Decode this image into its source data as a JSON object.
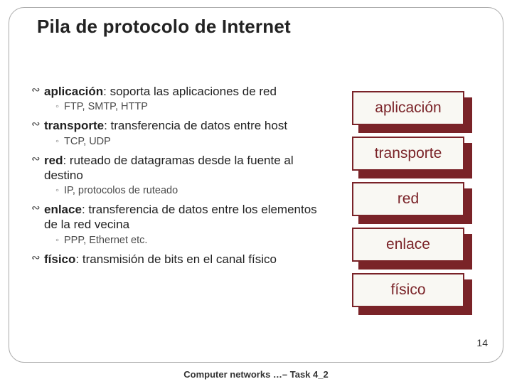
{
  "title": "Pila de protocolo de Internet",
  "items": [
    {
      "name": "aplicación",
      "desc": ": soporta las aplicaciones de red",
      "sub": "FTP, SMTP, HTTP"
    },
    {
      "name": "transporte",
      "desc": ": transferencia de datos entre host",
      "sub": "TCP, UDP"
    },
    {
      "name": "red",
      "desc": ": ruteado de datagramas desde la fuente al destino",
      "sub": "IP, protocolos de ruteado"
    },
    {
      "name": "enlace",
      "desc": ": transferencia de datos entre los elementos de la red vecina",
      "sub": "PPP, Ethernet etc."
    },
    {
      "name": "físico",
      "desc": ": transmisión de bits en el canal físico",
      "sub": ""
    }
  ],
  "layers": [
    "aplicación",
    "transporte",
    "red",
    "enlace",
    "físico"
  ],
  "page_number": "14",
  "footer": "Computer networks …– Task 4_2",
  "glyphs": {
    "bullet": "∾",
    "sub": "◦"
  }
}
